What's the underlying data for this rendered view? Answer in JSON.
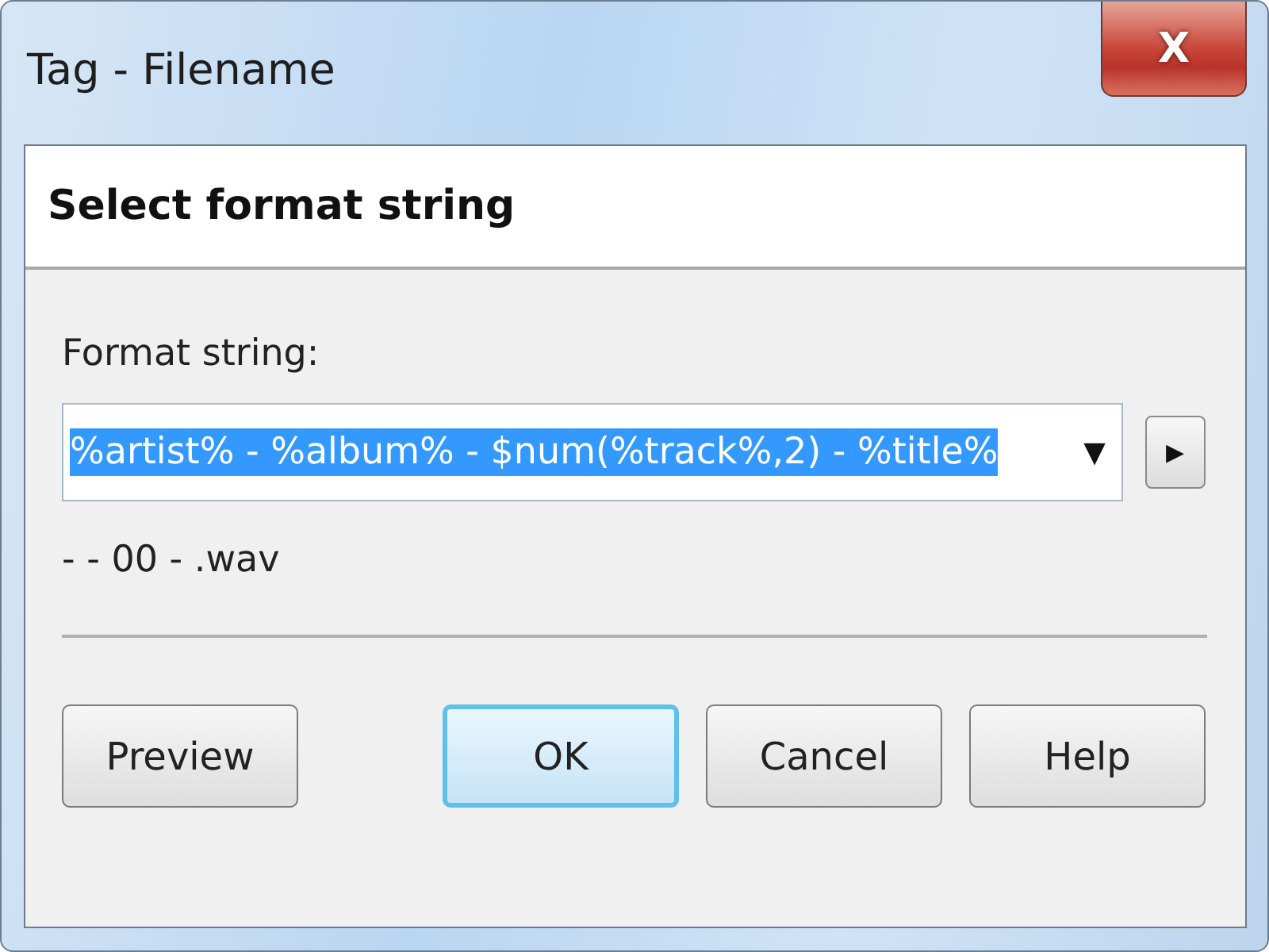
{
  "window": {
    "title": "Tag - Filename",
    "close_label": "X"
  },
  "header": {
    "title": "Select format string"
  },
  "format": {
    "label": "Format string:",
    "value": "%artist% - %album% - $num(%track%,2) - %title%",
    "selected": true,
    "arrow": "▼",
    "menu_arrow": "▶"
  },
  "preview_text": "-  - 00 - .wav",
  "buttons": [
    {
      "label": "Preview",
      "default": false
    },
    {
      "label": "OK",
      "default": true
    },
    {
      "label": "Cancel",
      "default": false
    },
    {
      "label": "Help",
      "default": false
    }
  ]
}
